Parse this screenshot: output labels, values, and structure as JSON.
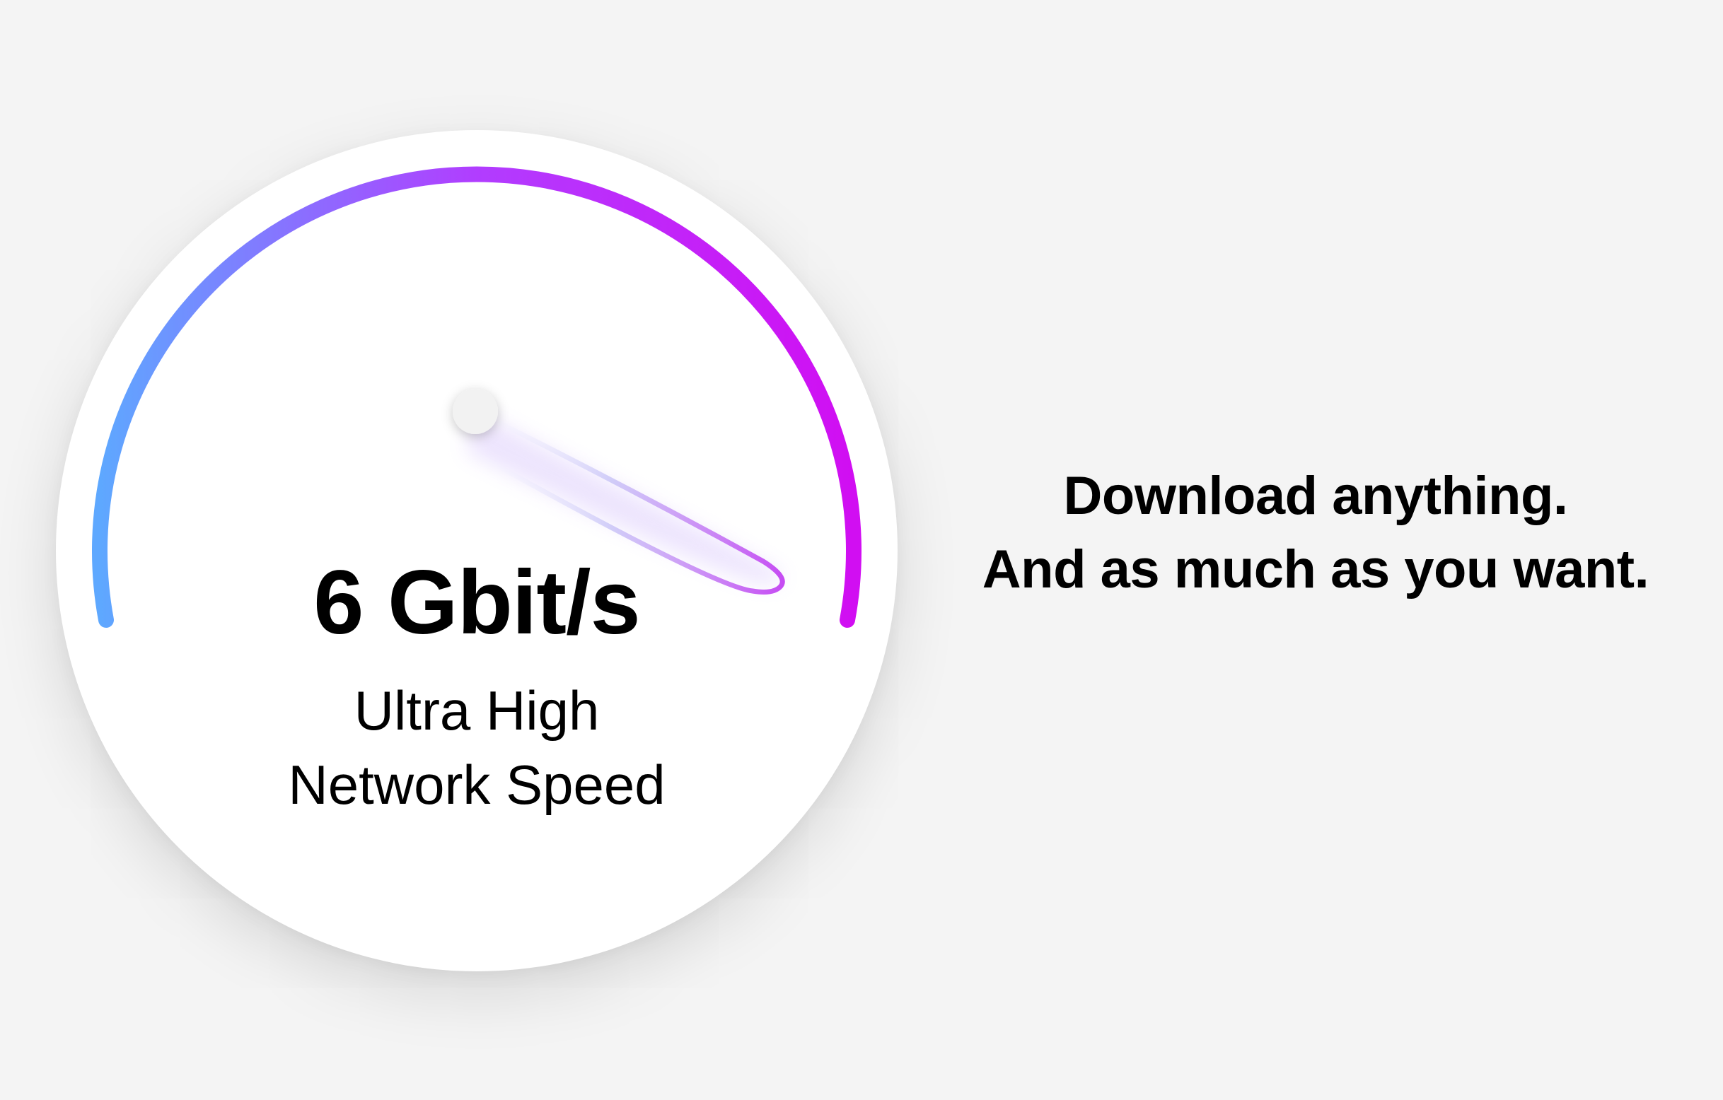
{
  "gauge": {
    "speed_value": "6 Gbit/s",
    "caption_line1": "Ultra High",
    "caption_line2": "Network Speed",
    "level_fraction": 0.82,
    "colors": {
      "arc_start": "#5ea8ff",
      "arc_mid": "#b13dff",
      "arc_end": "#d10ef2"
    }
  },
  "tagline": {
    "line1": "Download anything.",
    "line2": "And as much as you want."
  }
}
